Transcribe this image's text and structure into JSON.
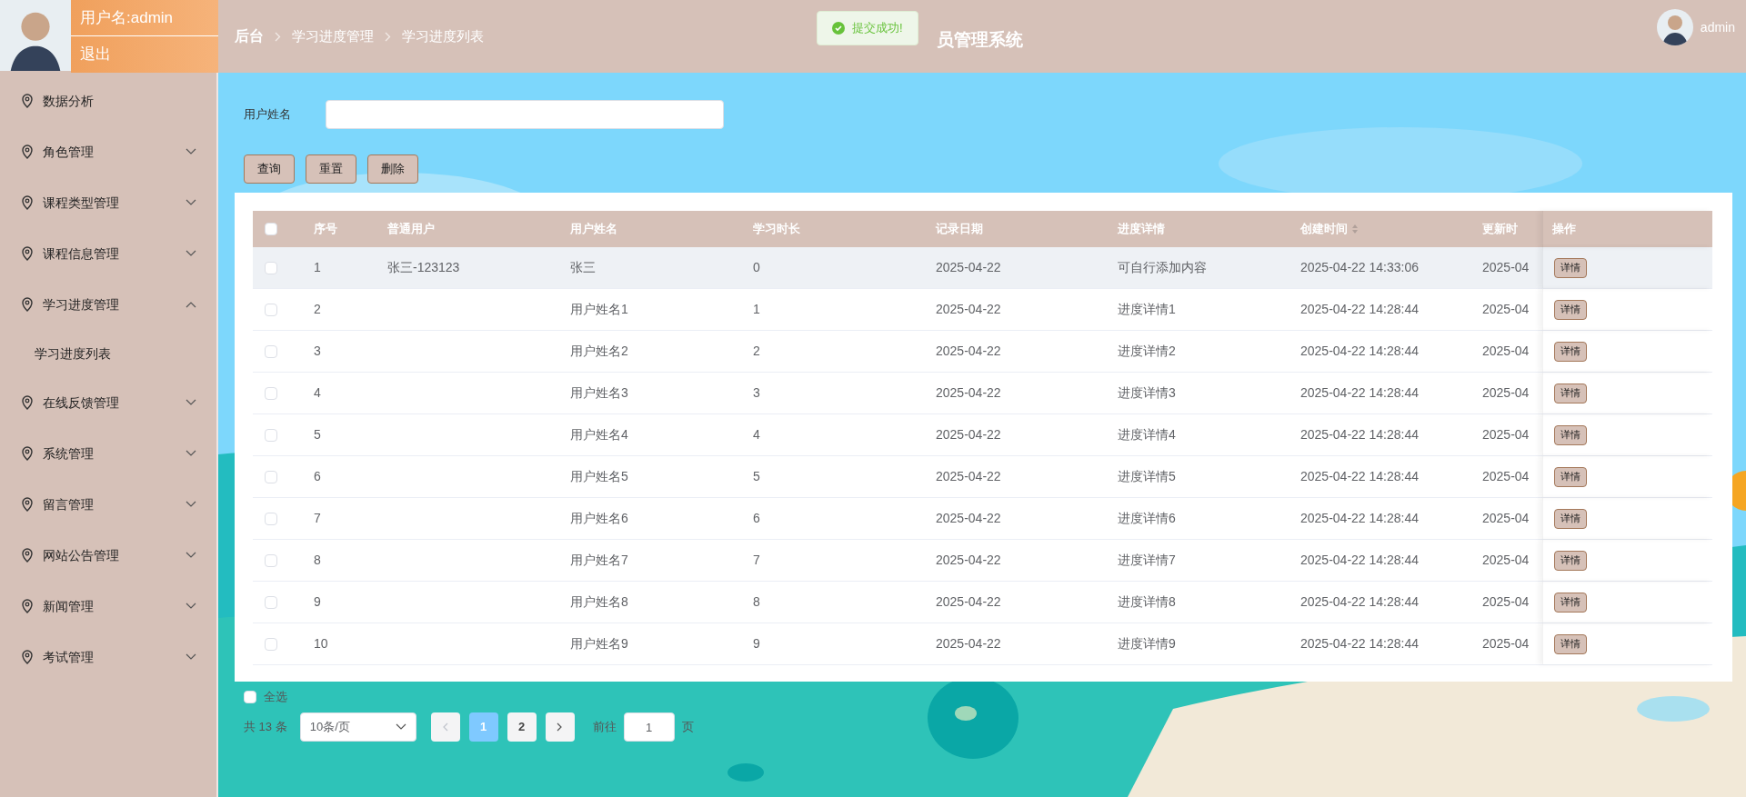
{
  "user_panel": {
    "username": "用户名:admin",
    "logout": "退出"
  },
  "breadcrumb": [
    "后台",
    "学习进度管理",
    "学习进度列表"
  ],
  "toast": {
    "message": "提交成功!"
  },
  "app_title": "员管理系统",
  "top_user": {
    "name": "admin"
  },
  "sidebar": {
    "items": [
      {
        "label": "数据分析",
        "kind": "link"
      },
      {
        "label": "角色管理",
        "kind": "group",
        "expanded": false
      },
      {
        "label": "课程类型管理",
        "kind": "group",
        "expanded": false
      },
      {
        "label": "课程信息管理",
        "kind": "group",
        "expanded": false
      },
      {
        "label": "学习进度管理",
        "kind": "group",
        "expanded": true,
        "children": [
          {
            "label": "学习进度列表"
          }
        ]
      },
      {
        "label": "在线反馈管理",
        "kind": "group",
        "expanded": false
      },
      {
        "label": "系统管理",
        "kind": "group",
        "expanded": false
      },
      {
        "label": "留言管理",
        "kind": "group",
        "expanded": false
      },
      {
        "label": "网站公告管理",
        "kind": "group",
        "expanded": false
      },
      {
        "label": "新闻管理",
        "kind": "group",
        "expanded": false
      },
      {
        "label": "考试管理",
        "kind": "group",
        "expanded": false
      }
    ]
  },
  "search": {
    "label": "用户姓名",
    "buttons": [
      "查询",
      "重置",
      "删除"
    ]
  },
  "table": {
    "header_checked": false,
    "columns": [
      {
        "label": "序号",
        "kind": "plain"
      },
      {
        "label": "普通用户",
        "kind": "plain"
      },
      {
        "label": "用户姓名",
        "kind": "plain"
      },
      {
        "label": "学习时长",
        "kind": "plain"
      },
      {
        "label": "记录日期",
        "kind": "plain"
      },
      {
        "label": "进度详情",
        "kind": "plain"
      },
      {
        "label": "创建时间",
        "kind": "sortable"
      },
      {
        "label": "更新时",
        "kind": "plain"
      },
      {
        "label": "操作",
        "kind": "plain"
      }
    ],
    "rows": [
      {
        "cells": [
          "1",
          "张三-123123",
          "张三",
          "0",
          "2025-04-22",
          "可自行添加内容",
          "2025-04-22 14:33:06",
          "2025-04"
        ],
        "action": "详情",
        "checked": false,
        "hovered": true
      },
      {
        "cells": [
          "2",
          "",
          "用户姓名1",
          "1",
          "2025-04-22",
          "进度详情1",
          "2025-04-22 14:28:44",
          "2025-04"
        ],
        "action": "详情",
        "checked": false,
        "hovered": false
      },
      {
        "cells": [
          "3",
          "",
          "用户姓名2",
          "2",
          "2025-04-22",
          "进度详情2",
          "2025-04-22 14:28:44",
          "2025-04"
        ],
        "action": "详情",
        "checked": false,
        "hovered": false
      },
      {
        "cells": [
          "4",
          "",
          "用户姓名3",
          "3",
          "2025-04-22",
          "进度详情3",
          "2025-04-22 14:28:44",
          "2025-04"
        ],
        "action": "详情",
        "checked": false,
        "hovered": false
      },
      {
        "cells": [
          "5",
          "",
          "用户姓名4",
          "4",
          "2025-04-22",
          "进度详情4",
          "2025-04-22 14:28:44",
          "2025-04"
        ],
        "action": "详情",
        "checked": false,
        "hovered": false
      },
      {
        "cells": [
          "6",
          "",
          "用户姓名5",
          "5",
          "2025-04-22",
          "进度详情5",
          "2025-04-22 14:28:44",
          "2025-04"
        ],
        "action": "详情",
        "checked": false,
        "hovered": false
      },
      {
        "cells": [
          "7",
          "",
          "用户姓名6",
          "6",
          "2025-04-22",
          "进度详情6",
          "2025-04-22 14:28:44",
          "2025-04"
        ],
        "action": "详情",
        "checked": false,
        "hovered": false
      },
      {
        "cells": [
          "8",
          "",
          "用户姓名7",
          "7",
          "2025-04-22",
          "进度详情7",
          "2025-04-22 14:28:44",
          "2025-04"
        ],
        "action": "详情",
        "checked": false,
        "hovered": false
      },
      {
        "cells": [
          "9",
          "",
          "用户姓名8",
          "8",
          "2025-04-22",
          "进度详情8",
          "2025-04-22 14:28:44",
          "2025-04"
        ],
        "action": "详情",
        "checked": false,
        "hovered": false
      },
      {
        "cells": [
          "10",
          "",
          "用户姓名9",
          "9",
          "2025-04-22",
          "进度详情9",
          "2025-04-22 14:28:44",
          "2025-04"
        ],
        "action": "详情",
        "checked": false,
        "hovered": false
      }
    ]
  },
  "select_all": {
    "label": "全选",
    "checked": false
  },
  "pagination": {
    "total": "共 13 条",
    "page_size": "10条/页",
    "pages": [
      {
        "label": "1",
        "selected": true
      },
      {
        "label": "2",
        "selected": false
      }
    ],
    "goto_label": "前往",
    "goto_value": "1",
    "goto_suffix": "页"
  }
}
